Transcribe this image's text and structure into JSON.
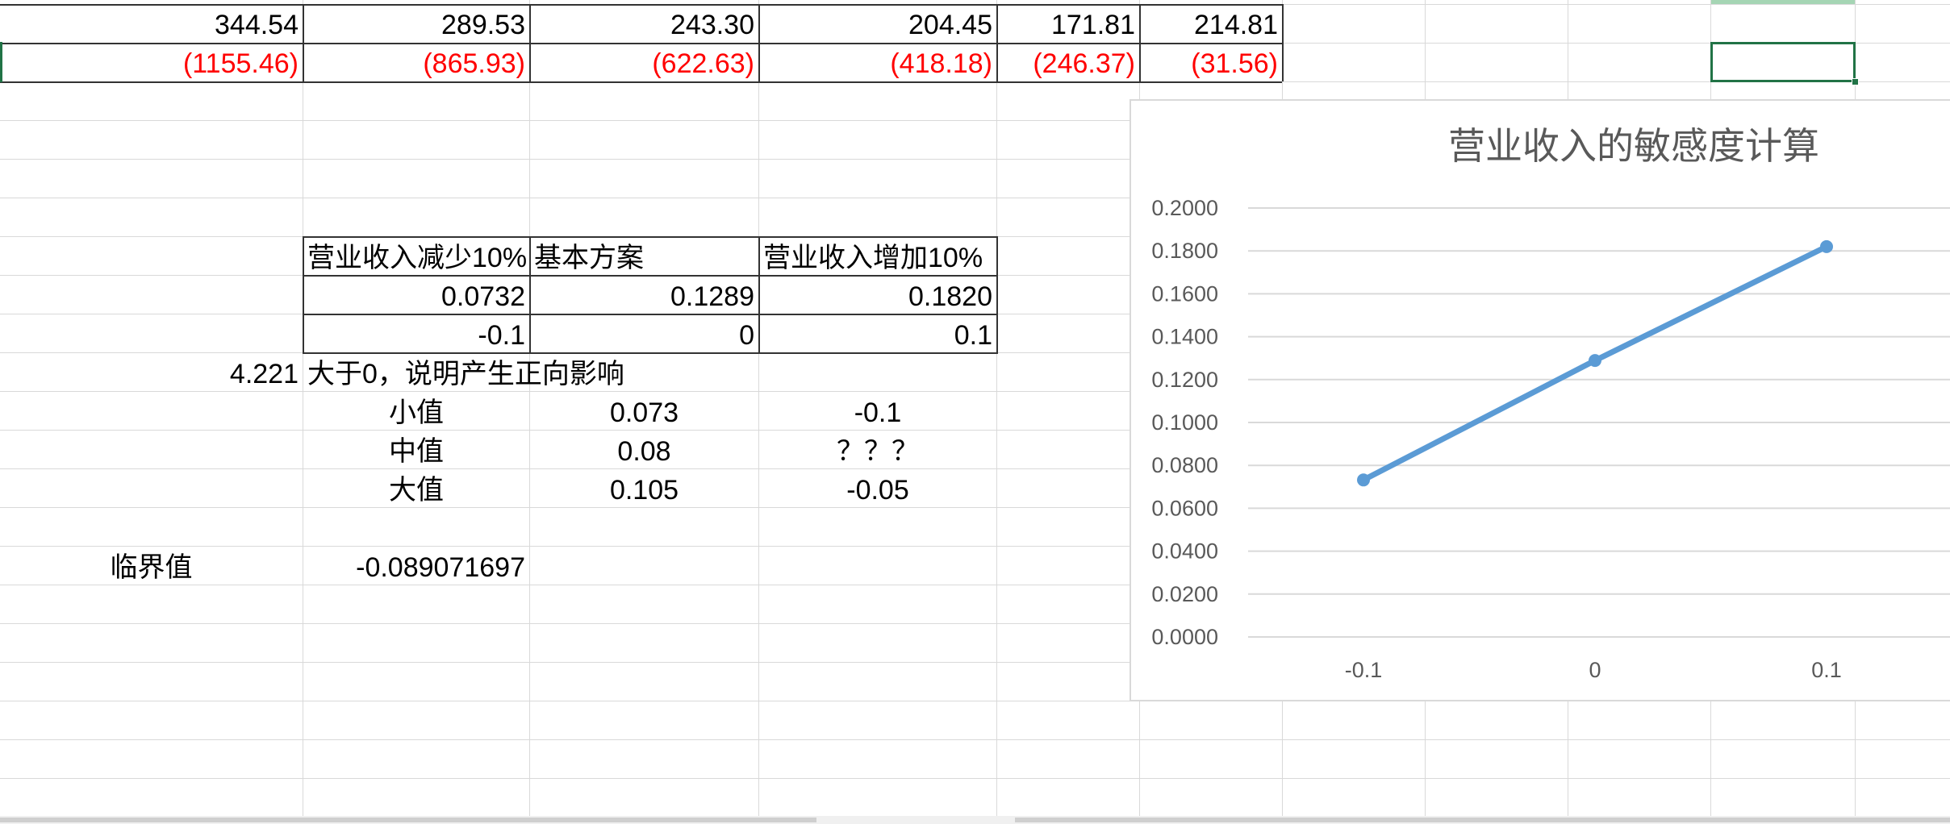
{
  "row1": [
    "344.54",
    "289.53",
    "243.30",
    "204.45",
    "171.81",
    "214.81"
  ],
  "row2": [
    "(1155.46)",
    "(865.93)",
    "(622.63)",
    "(418.18)",
    "(246.37)",
    "(31.56)"
  ],
  "table": {
    "headers": [
      "营业收入减少10%",
      "基本方案",
      "营业收入增加10%"
    ],
    "values": [
      "0.0732",
      "0.1289",
      "0.1820"
    ],
    "changes": [
      "-0.1",
      "0",
      "0.1"
    ]
  },
  "sensitivity": {
    "value": "4.221",
    "note": "大于0，说明产生正向影响"
  },
  "interp": {
    "rows": [
      {
        "label": "小值",
        "value": "0.073",
        "x": "-0.1"
      },
      {
        "label": "中值",
        "value": "0.08",
        "x": "？？？"
      },
      {
        "label": "大值",
        "value": "0.105",
        "x": "-0.05"
      }
    ]
  },
  "critical": {
    "label": "临界值",
    "value": "-0.089071697"
  },
  "chart_data": {
    "type": "line",
    "title": "营业收入的敏感度计算",
    "categories": [
      "-0.1",
      "0",
      "0.1"
    ],
    "series": [
      {
        "values": [
          0.0732,
          0.1289,
          0.182
        ],
        "color": "#5b9bd5"
      }
    ],
    "ylim": [
      0,
      0.2
    ],
    "yticks": [
      "0.0000",
      "0.0200",
      "0.0400",
      "0.0600",
      "0.0800",
      "0.1000",
      "0.1200",
      "0.1400",
      "0.1600",
      "0.1800",
      "0.2000"
    ],
    "grid": true,
    "xlabel": "",
    "ylabel": ""
  }
}
